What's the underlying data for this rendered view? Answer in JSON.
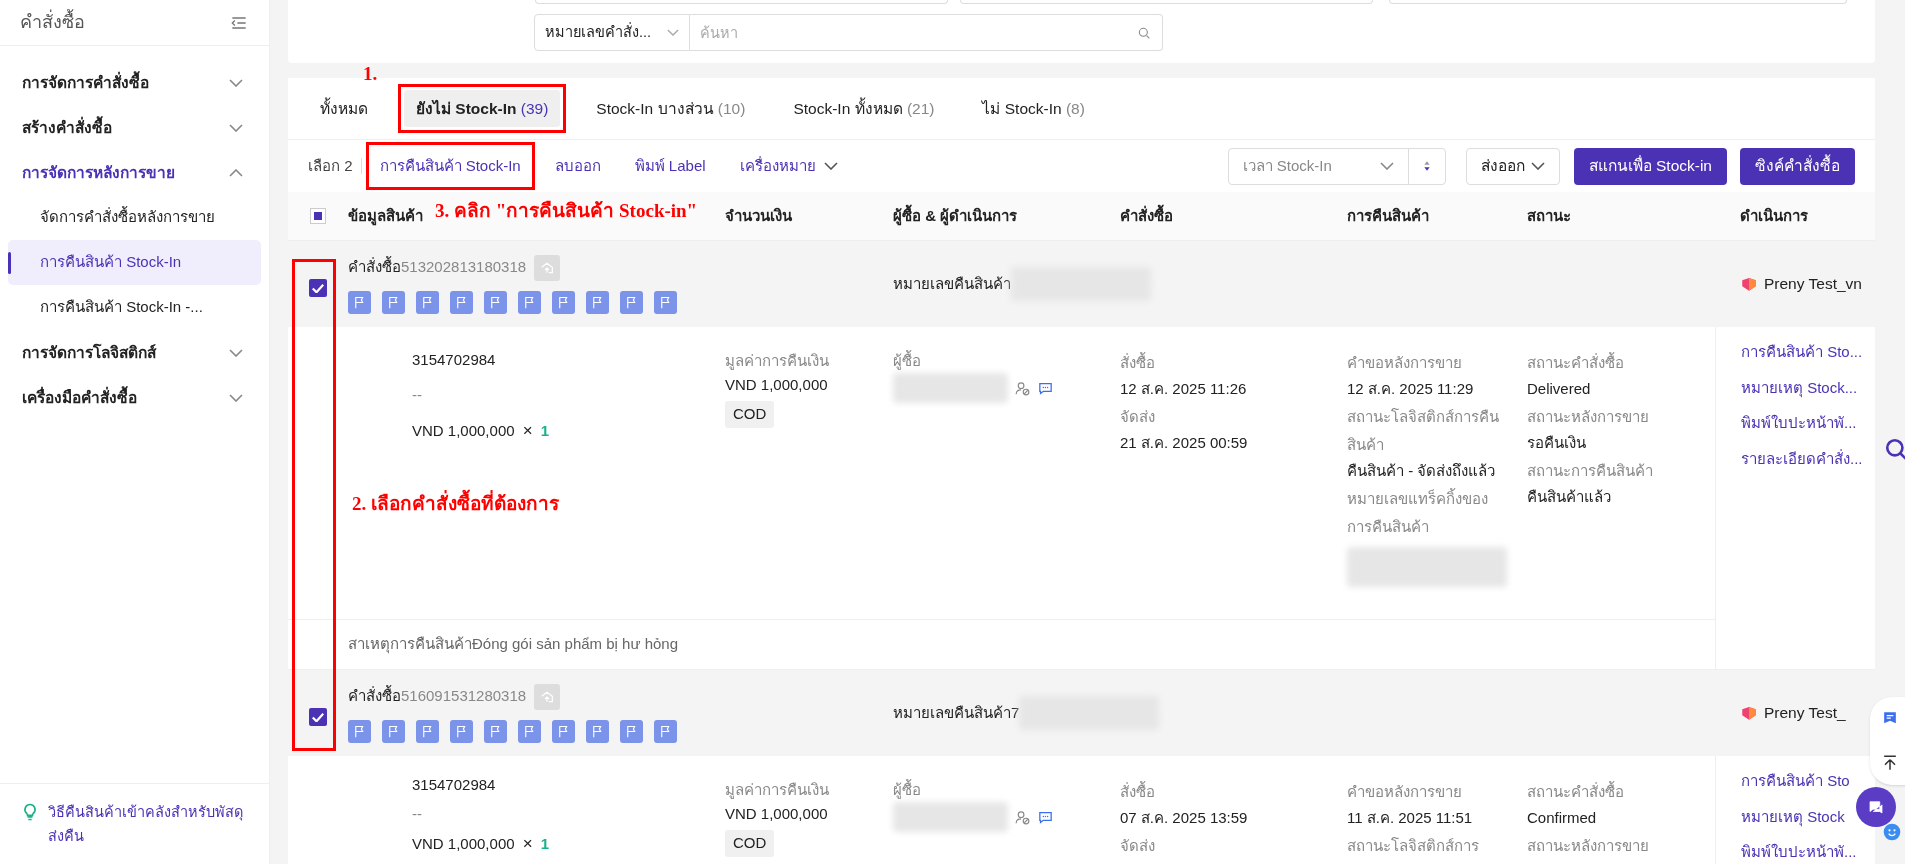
{
  "sidebar": {
    "title": "คำสั่งซื้อ",
    "menu": [
      {
        "label": "การจัดการคำสั่งซื้อ",
        "expanded": false
      },
      {
        "label": "สร้างคำสั่งซื้อ",
        "expanded": false
      },
      {
        "label": "การจัดการหลังการขาย",
        "expanded": true,
        "children": [
          {
            "label": "จัดการคำสั่งซื้อหลังการขาย",
            "selected": false
          },
          {
            "label": "การคืนสินค้า Stock-In",
            "selected": true
          },
          {
            "label": "การคืนสินค้า Stock-In -...",
            "selected": false
          }
        ]
      },
      {
        "label": "การจัดการโลจิสติกส์",
        "expanded": false
      },
      {
        "label": "เครื่องมือคำสั่งซื้อ",
        "expanded": false
      }
    ],
    "tip": "วิธีคืนสินค้าเข้าคลังสำหรับพัสดุส่งคืน"
  },
  "search": {
    "type": "หมายเลขคำสั่ง...",
    "placeholder": "ค้นหา"
  },
  "tabs": [
    {
      "label": "ทั้งหมด",
      "selected": false
    },
    {
      "label": "ยังไม่ Stock-In",
      "count": "(39)",
      "selected": true
    },
    {
      "label": "Stock-In บางส่วน",
      "count": "(10)",
      "selected": false
    },
    {
      "label": "Stock-In ทั้งหมด",
      "count": "(21)",
      "selected": false
    },
    {
      "label": "ไม่ Stock-In",
      "count": "(8)",
      "selected": false
    }
  ],
  "bulk": {
    "selected_text": "เลือก 2",
    "actions": [
      {
        "label": "การคืนสินค้า Stock-In",
        "kind": "link"
      },
      {
        "label": "ลบออก",
        "kind": "link"
      },
      {
        "label": "พิมพ์ Label",
        "kind": "link"
      },
      {
        "label": "เครื่องหมาย",
        "kind": "dropdown"
      }
    ]
  },
  "sort": {
    "label": "เวลา Stock-In"
  },
  "export": "ส่งออก",
  "buttons": [
    "สแกนเพื่อ Stock-in",
    "ซิงค์คำสั่งซื้อ"
  ],
  "table": {
    "header_indeterminate": true,
    "columns": [
      "ข้อมูลสินค้า",
      "จำนวนเงิน",
      "ผู้ซื้อ & ผู้ดำเนินการ",
      "คำสั่งซื้อ",
      "การคืนสินค้า",
      "สถานะ",
      "ดำเนินการ"
    ],
    "orders": [
      {
        "checked": true,
        "order_label": "คำสั่งซื้อ",
        "order_no": "513202813180318",
        "return_no_label": "หมายเลขคืนสินค้า",
        "shop": "Preny Test_vn",
        "sku": "3154702984",
        "variant": "--",
        "price": "VND 1,000,000",
        "times": "×",
        "qty": "1",
        "amount_label": "มูลค่าการคืนเงิน",
        "amount": "VND 1,000,000",
        "payment": "COD",
        "buyer_label": "ผู้ซื้อ",
        "order_info": [
          {
            "label": "สั่งซื้อ",
            "value": "12 ส.ค. 2025 11:26"
          },
          {
            "label": "จัดส่ง",
            "value": "21 ส.ค. 2025 00:59"
          }
        ],
        "return_info": [
          {
            "label": "คำขอหลังการขาย",
            "value": "12 ส.ค. 2025 11:29"
          },
          {
            "label": "สถานะโลจิสติกส์การคืนสินค้า",
            "value": "คืนสินค้า - จัดส่งถึงแล้ว"
          },
          {
            "label": "หมายเลขแทร็คกิ้งของการคืนสินค้า"
          }
        ],
        "status": [
          {
            "label": "สถานะคำสั่งซื้อ",
            "value": "Delivered"
          },
          {
            "label": "สถานะหลังการขาย",
            "value": "รอคืนเงิน"
          },
          {
            "label": "สถานะการคืนสินค้า",
            "value": "คืนสินค้าแล้ว"
          }
        ],
        "actions": [
          "การคืนสินค้า Sto...",
          "หมายเหตุ Stock...",
          "พิมพ์ใบปะหน้าพั...",
          "รายละเอียดคำสั่ง..."
        ],
        "reason": "สาเหตุการคืนสินค้าĐóng gói sản phẩm bị hư hỏng"
      },
      {
        "checked": true,
        "order_label": "คำสั่งซื้อ",
        "order_no": "516091531280318",
        "return_no_label": "หมายเลขคืนสินค้า7",
        "shop": "Preny Test_",
        "sku": "3154702984",
        "variant": "--",
        "price": "VND 1,000,000",
        "times": "×",
        "qty": "1",
        "amount_label": "มูลค่าการคืนเงิน",
        "amount": "VND 1,000,000",
        "payment": "COD",
        "buyer_label": "ผู้ซื้อ",
        "order_info": [
          {
            "label": "สั่งซื้อ",
            "value": "07 ส.ค. 2025 13:59"
          },
          {
            "label": "จัดส่ง"
          }
        ],
        "return_info": [
          {
            "label": "คำขอหลังการขาย",
            "value": "11 ส.ค. 2025 11:51"
          },
          {
            "label": "สถานะโลจิสติกส์การ"
          }
        ],
        "status": [
          {
            "label": "สถานะคำสั่งซื้อ",
            "value": "Confirmed"
          },
          {
            "label": "สถานะหลังการขาย"
          }
        ],
        "actions": [
          "การคืนสินค้า Sto",
          "หมายเหตุ Stock",
          "พิมพ์ใบปะหน้าพั..."
        ]
      }
    ]
  },
  "annotations": [
    "1.",
    "3. คลิก \"การคืนสินค้า Stock-in\"",
    "2. เลือกคำสั่งซื้อที่ต้องการ"
  ]
}
